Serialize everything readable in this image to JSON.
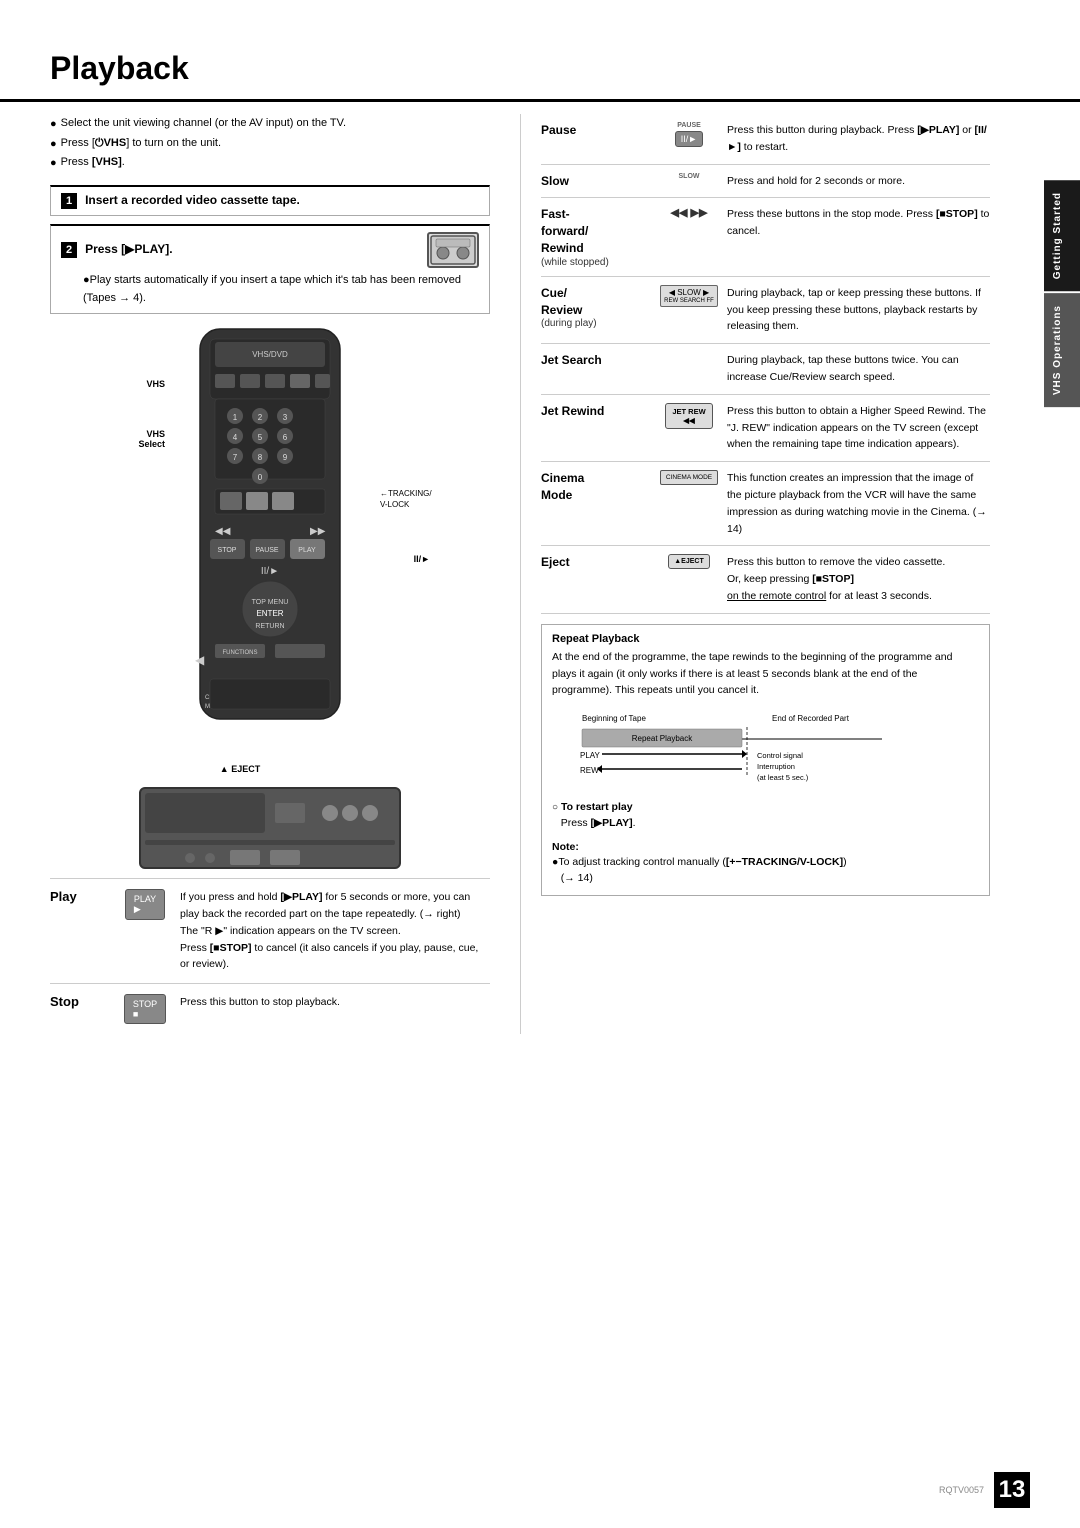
{
  "page": {
    "title": "Playback",
    "page_number": "13",
    "page_code": "RQTV0057"
  },
  "side_tabs": [
    {
      "id": "getting-started",
      "label": "Getting Started"
    },
    {
      "id": "vhs-operations",
      "label": "VHS Operations"
    }
  ],
  "intro_bullets": [
    "Select the unit viewing channel (or the AV input) on the TV.",
    "Press [⏻VHS] to turn on the unit.",
    "Press [VHS]."
  ],
  "steps": [
    {
      "number": "1",
      "title": "Insert a recorded video cassette tape."
    },
    {
      "number": "2",
      "title": "Press [▶PLAY].",
      "sub_bullets": [
        "Play starts automatically if you insert a tape which it's tab has been removed (Tapes → 4)."
      ]
    }
  ],
  "remote_labels": {
    "vhs": "VHS",
    "vhs_select": "VHS Select",
    "tracking": "←TRACKING/ V-LOCK",
    "slow_ii": "II/►"
  },
  "vcr_labels": {
    "eject": "▲ EJECT"
  },
  "play_section": {
    "label": "Play",
    "desc": "If you press and hold [▶PLAY] for 5 seconds or more, you can play back the recorded part on the tape repeatedly. (→ right)\nThe \"R ▶\" indication appears on the TV screen.\nPress [■STOP] to cancel (it also cancels if you play, pause, cue, or review)."
  },
  "stop_section": {
    "label": "Stop",
    "desc": "Press this button to stop playback."
  },
  "right_features": [
    {
      "id": "pause",
      "title": "Pause",
      "sub": "",
      "icon_label": "PAUSE\nII/►",
      "desc": "Press this button during playback. Press [▶PLAY] or [II/►] to restart."
    },
    {
      "id": "slow",
      "title": "Slow",
      "sub": "",
      "icon_label": "SLOW",
      "desc": "Press and hold for 2 seconds or more."
    },
    {
      "id": "fast-forward-rewind",
      "title": "Fast-forward/ Rewind",
      "sub": "(while stopped)",
      "icon_label": "◀◀ ▶▶",
      "desc": "Press these buttons in the stop mode. Press [■STOP] to cancel."
    },
    {
      "id": "cue-review",
      "title": "Cue/ Review",
      "sub": "(during play)",
      "icon_label": "REW SEARCH FF",
      "desc": "During playback, tap or keep pressing these buttons. If you keep pressing these buttons, playback restarts by releasing them."
    },
    {
      "id": "jet-search",
      "title": "Jet Search",
      "sub": "",
      "icon_label": "",
      "desc": "During playback, tap these buttons twice. You can increase Cue/Review search speed."
    },
    {
      "id": "jet-rewind",
      "title": "Jet Rewind",
      "sub": "",
      "icon_label": "JET REW",
      "desc": "Press this button to obtain a Higher Speed Rewind. The \"J. REW\" indication appears on the TV screen (except when the remaining tape time indication appears)."
    },
    {
      "id": "cinema-mode",
      "title": "Cinema Mode",
      "sub": "",
      "icon_label": "CINEMA MODE",
      "desc": "This function creates an impression that the image of the picture playback from the VCR will have the same impression as during watching movie in the Cinema. (→ 14)"
    },
    {
      "id": "eject",
      "title": "Eject",
      "sub": "",
      "icon_label": "▲EJECT",
      "desc": "Press this button to remove the video cassette.\nOr, keep pressing [■STOP] on the remote control for at least 3 seconds."
    }
  ],
  "repeat_playback": {
    "title": "Repeat Playback",
    "desc": "At the end of the programme, the tape rewinds to the beginning of the programme and plays it again (it only works if there is at least 5 seconds blank at the end of the programme). This repeats until you cancel it.",
    "diagram": {
      "beginning_label": "Beginning of Tape",
      "end_label": "End of Recorded Part",
      "repeat_label": "Repeat Playback",
      "play_label": "PLAY",
      "rew_label": "REW",
      "control_signal": "Control signal Interruption (at least 5 sec.)"
    }
  },
  "footer_notes": [
    {
      "id": "restart-play",
      "title": "To restart play",
      "content": "Press [▶PLAY].",
      "type": "circle-bullet"
    },
    {
      "id": "note",
      "title": "Note:",
      "content": "●To adjust tracking control manually ([+−TRACKING/V-LOCK]) (→ 14)",
      "type": "bold-note"
    }
  ]
}
